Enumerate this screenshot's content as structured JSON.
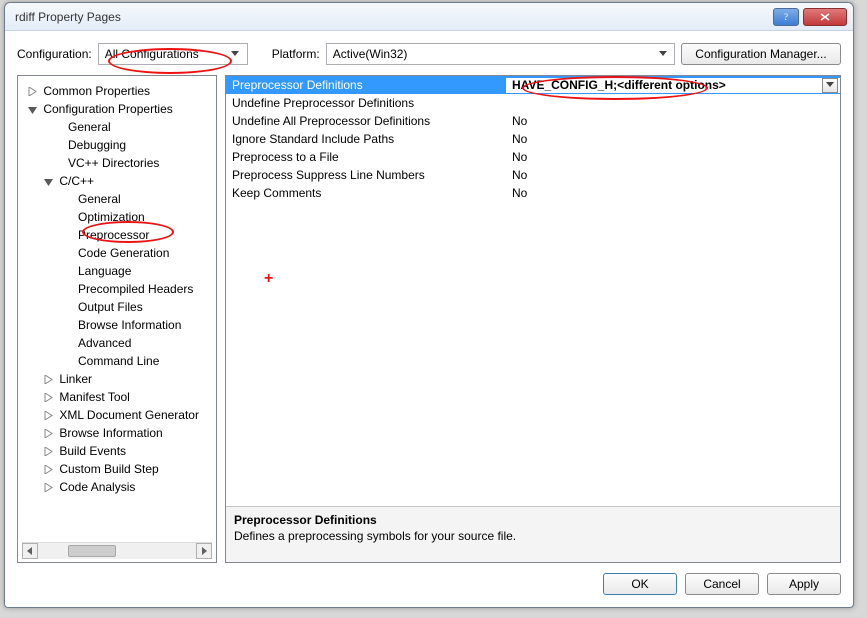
{
  "window": {
    "title": "rdiff Property Pages"
  },
  "toprow": {
    "config_label": "Configuration:",
    "config_value": "All Configurations",
    "platform_label": "Platform:",
    "platform_value": "Active(Win32)",
    "config_mgr": "Configuration Manager..."
  },
  "tree": {
    "common": "Common Properties",
    "config": "Configuration Properties",
    "general": "General",
    "debugging": "Debugging",
    "vcdirs": "VC++ Directories",
    "ccpp": "C/C++",
    "cc_general": "General",
    "cc_opt": "Optimization",
    "cc_prepro": "Preprocessor",
    "cc_codegen": "Code Generation",
    "cc_lang": "Language",
    "cc_pch": "Precompiled Headers",
    "cc_out": "Output Files",
    "cc_browse": "Browse Information",
    "cc_adv": "Advanced",
    "cc_cmd": "Command Line",
    "linker": "Linker",
    "manifest": "Manifest Tool",
    "xml": "XML Document Generator",
    "browse": "Browse Information",
    "buildev": "Build Events",
    "custom": "Custom Build Step",
    "codean": "Code Analysis"
  },
  "props": {
    "rows": [
      {
        "name": "Preprocessor Definitions",
        "value": "HAVE_CONFIG_H;<different options>"
      },
      {
        "name": "Undefine Preprocessor Definitions",
        "value": ""
      },
      {
        "name": "Undefine All Preprocessor Definitions",
        "value": "No"
      },
      {
        "name": "Ignore Standard Include Paths",
        "value": "No"
      },
      {
        "name": "Preprocess to a File",
        "value": "No"
      },
      {
        "name": "Preprocess Suppress Line Numbers",
        "value": "No"
      },
      {
        "name": "Keep Comments",
        "value": "No"
      }
    ],
    "desc_title": "Preprocessor Definitions",
    "desc_text": "Defines a preprocessing symbols for your source file."
  },
  "buttons": {
    "ok": "OK",
    "cancel": "Cancel",
    "apply": "Apply"
  }
}
